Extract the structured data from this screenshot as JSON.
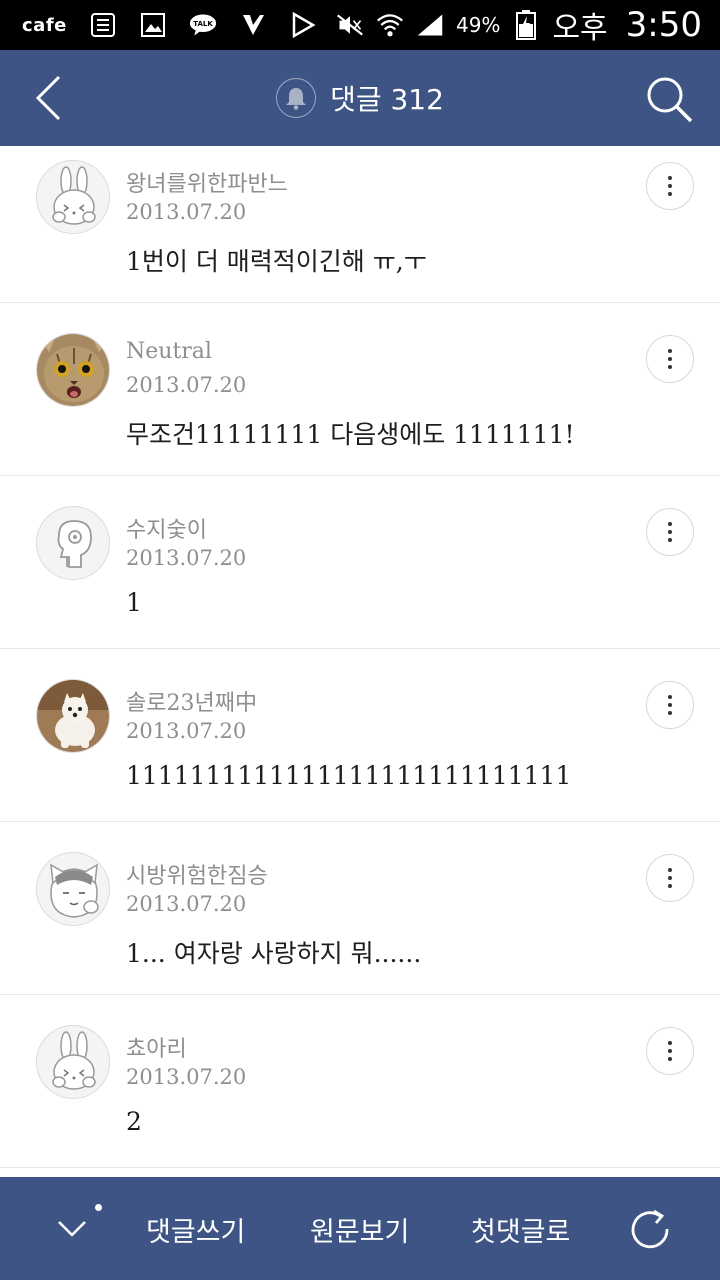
{
  "status_bar": {
    "cafe": "cafe",
    "battery": "49%",
    "ampm": "오후",
    "time": "3:50",
    "icons": [
      "list-icon",
      "image-icon",
      "talk-icon",
      "check-icon",
      "play-store-icon",
      "mute-icon",
      "wifi-icon",
      "signal-icon",
      "battery-icon"
    ]
  },
  "header": {
    "title": "댓글 312",
    "icons": [
      "back-arrow-icon",
      "bell-icon",
      "search-icon"
    ],
    "bg_color": "#3e5484"
  },
  "comments": [
    {
      "name": "왕녀를위한파반느",
      "date": "2013.07.20",
      "text": "1번이 더 매력적이긴해 ㅠ,ㅜ",
      "avatar": "rabbit-avatar"
    },
    {
      "name": "Neutral",
      "date": "2013.07.20",
      "text": "무조건11111111 다음생에도 1111111!",
      "avatar": "cat-photo-avatar"
    },
    {
      "name": "수지숯이",
      "date": "2013.07.20",
      "text": "1",
      "avatar": "mascot-avatar"
    },
    {
      "name": "솔로23년째中",
      "date": "2013.07.20",
      "text": "1111111111111111111111111111",
      "avatar": "dog-photo-avatar"
    },
    {
      "name": "시방위험한짐승",
      "date": "2013.07.20",
      "text": "1... 여자랑 사랑하지 뭐......",
      "avatar": "neo-cat-avatar"
    },
    {
      "name": "쵸아리",
      "date": "2013.07.20",
      "text": "2",
      "avatar": "rabbit-avatar"
    }
  ],
  "bottom_bar": {
    "write": "댓글쓰기",
    "original": "원문보기",
    "first": "첫댓글로",
    "icons": [
      "chevron-down-icon",
      "refresh-icon"
    ]
  }
}
